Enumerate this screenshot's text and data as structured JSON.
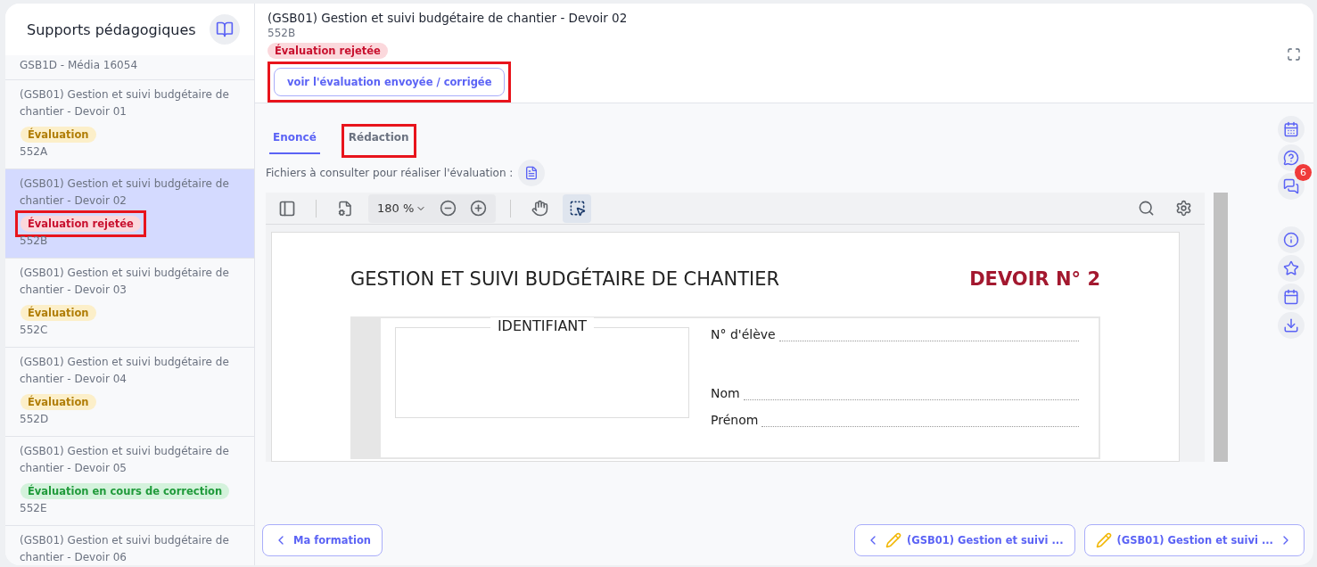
{
  "sidebar": {
    "title": "Supports pédagogiques",
    "items": [
      {
        "title": "GSB1D - Média 16054",
        "selected": false
      },
      {
        "title": "(GSB01) Gestion et suivi budgétaire de chantier - Devoir 01",
        "badge": {
          "label": "Évaluation",
          "kind": "pending"
        },
        "code": "552A",
        "selected": false
      },
      {
        "title": "(GSB01) Gestion et suivi budgétaire de chantier - Devoir 02",
        "badge": {
          "label": "Évaluation rejetée",
          "kind": "rejected"
        },
        "code": "552B",
        "selected": true,
        "highlighted": true
      },
      {
        "title": "(GSB01) Gestion et suivi budgétaire de chantier - Devoir 03",
        "badge": {
          "label": "Évaluation",
          "kind": "pending"
        },
        "code": "552C",
        "selected": false
      },
      {
        "title": "(GSB01) Gestion et suivi budgétaire de chantier - Devoir 04",
        "badge": {
          "label": "Évaluation",
          "kind": "pending"
        },
        "code": "552D",
        "selected": false
      },
      {
        "title": "(GSB01) Gestion et suivi budgétaire de chantier - Devoir 05",
        "badge": {
          "label": "Évaluation en cours de correction",
          "kind": "grading"
        },
        "code": "552E",
        "selected": false
      },
      {
        "title": "(GSB01) Gestion et suivi budgétaire de chantier - Devoir 06",
        "selected": false
      }
    ]
  },
  "header": {
    "title": "(GSB01) Gestion et suivi budgétaire de chantier - Devoir 02",
    "code": "552B",
    "badge": {
      "label": "Évaluation rejetée",
      "kind": "rejected"
    },
    "action": {
      "label": "voir l'évaluation envoyée / corrigée",
      "highlighted": true
    }
  },
  "tabs": [
    {
      "label": "Enoncé",
      "selected": true,
      "highlighted": false
    },
    {
      "label": "Rédaction",
      "selected": false,
      "highlighted": true
    }
  ],
  "files_label": "Fichiers à consulter pour réaliser l'évaluation :",
  "viewer": {
    "zoom": "180 %",
    "document": {
      "title": "GESTION ET SUIVI BUDGÉTAIRE DE CHANTIER",
      "assignment": "DEVOIR N° 2",
      "id_label": "IDENTIFIANT",
      "fields": [
        "N° d'élève",
        "Nom",
        "Prénom"
      ]
    }
  },
  "rail": {
    "chat_count": "6"
  },
  "footer": {
    "back": "Ma formation",
    "previous": "(GSB01) Gestion et suivi ...",
    "next": "(GSB01) Gestion et suivi ..."
  }
}
